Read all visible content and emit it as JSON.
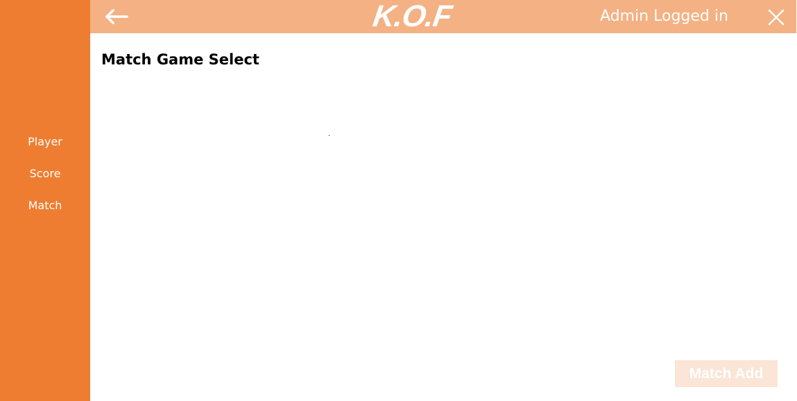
{
  "header": {
    "logo_text": "K.O.F",
    "login_status": "Admin Logged in",
    "back_icon": "arrow-left-icon",
    "close_icon": "close-icon"
  },
  "sidebar": {
    "items": [
      {
        "label": "Player"
      },
      {
        "label": "Score"
      },
      {
        "label": "Match"
      }
    ]
  },
  "main": {
    "title": "Match Game Select",
    "match_add_label": "Match Add"
  },
  "colors": {
    "sidebar_bg": "#ef7d31",
    "topbar_bg": "#f4b183",
    "button_bg": "#fbe5d6",
    "text_light": "#ffffff"
  }
}
